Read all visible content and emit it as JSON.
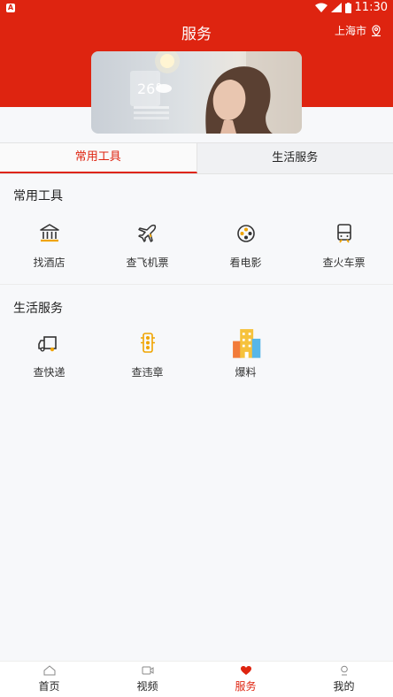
{
  "status": {
    "time": "11:30"
  },
  "header": {
    "title": "服务",
    "city": "上海市"
  },
  "tabs": [
    {
      "label": "常用工具",
      "active": true
    },
    {
      "label": "生活服务",
      "active": false
    }
  ],
  "sections": [
    {
      "title": "常用工具",
      "items": [
        {
          "label": "找酒店",
          "icon": "bank-icon"
        },
        {
          "label": "查飞机票",
          "icon": "airplane-icon"
        },
        {
          "label": "看电影",
          "icon": "film-reel-icon"
        },
        {
          "label": "查火车票",
          "icon": "train-icon"
        }
      ]
    },
    {
      "title": "生活服务",
      "items": [
        {
          "label": "查快递",
          "icon": "delivery-truck-icon"
        },
        {
          "label": "查违章",
          "icon": "traffic-light-icon"
        },
        {
          "label": "爆料",
          "icon": "buildings-icon"
        }
      ]
    }
  ],
  "tabbar": [
    {
      "label": "首页",
      "icon": "home-icon",
      "active": false
    },
    {
      "label": "视频",
      "icon": "video-icon",
      "active": false
    },
    {
      "label": "服务",
      "icon": "heart-icon",
      "active": true
    },
    {
      "label": "我的",
      "icon": "user-icon",
      "active": false
    }
  ],
  "colors": {
    "accent": "#de2410",
    "background": "#f7f8fa"
  }
}
